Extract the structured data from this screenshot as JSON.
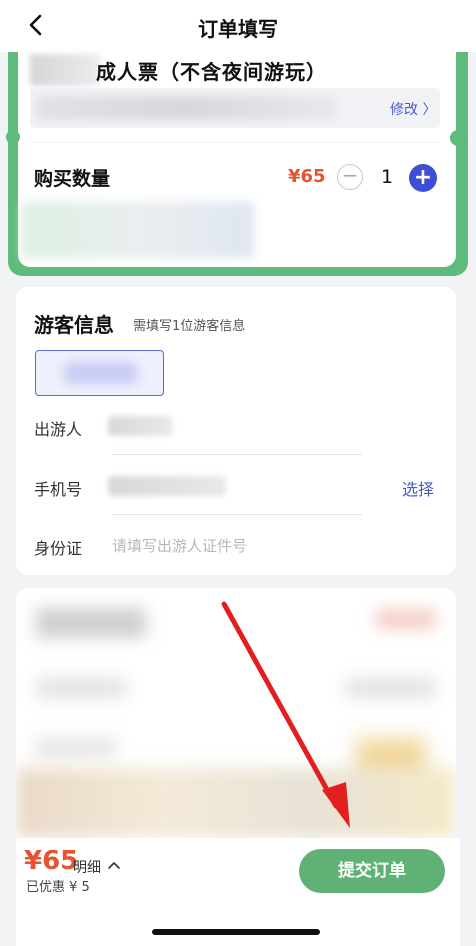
{
  "header": {
    "title": "订单填写"
  },
  "ticket": {
    "name": "成人票（不含夜间游玩）",
    "modify_label": "修改 〉",
    "quantity_label": "购买数量",
    "price": "¥65",
    "minus_label": "−",
    "quantity": "1",
    "plus_label": "+"
  },
  "visitor": {
    "title": "游客信息",
    "hint": "需填写1位游客信息",
    "traveler_label": "出游人",
    "phone_label": "手机号",
    "select_label": "选择",
    "id_label": "身份证",
    "id_placeholder": "请填写出游人证件号"
  },
  "footer": {
    "total": "¥65",
    "detail_label": "明细",
    "discount": "已优惠 ¥ 5",
    "submit_label": "提交订单"
  },
  "colors": {
    "accent_green": "#5fb175",
    "price_red": "#e8532f",
    "link_blue": "#4a5bc8",
    "arrow_red": "#e02020"
  }
}
